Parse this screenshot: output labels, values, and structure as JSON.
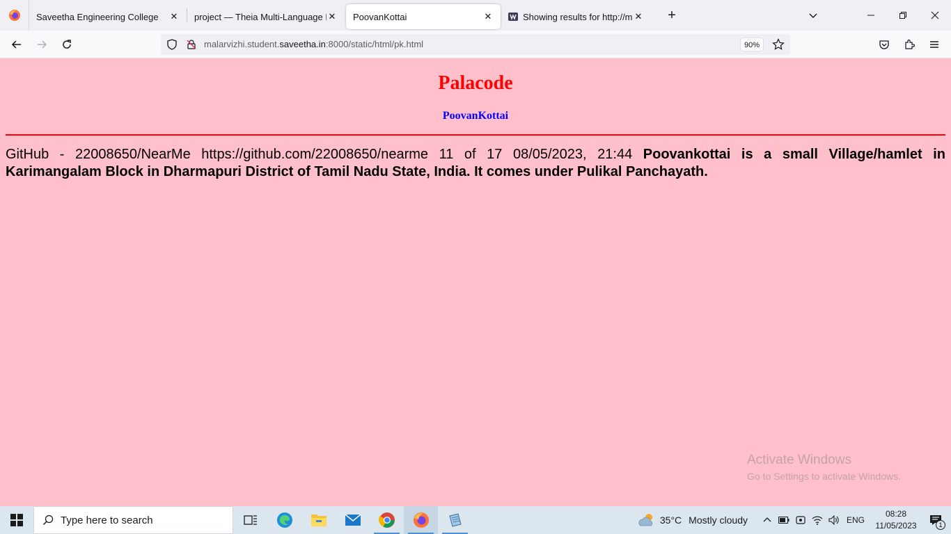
{
  "browser": {
    "tabs": [
      {
        "title": "Saveetha Engineering College",
        "active": false
      },
      {
        "title": "project — Theia Multi-Language Ex",
        "active": false
      },
      {
        "title": "PoovanKottai",
        "active": true
      },
      {
        "title": "Showing results for http://malar",
        "active": false
      }
    ],
    "url_prefix": "malarvizhi.student.",
    "url_host": "saveetha.in",
    "url_suffix": ":8000/static/html/pk.html",
    "zoom": "90%"
  },
  "page": {
    "title": "Palacode",
    "subtitle": "PoovanKottai",
    "paragraph_plain": "GitHub - 22008650/NearMe https://github.com/22008650/nearme 11 of 17 08/05/2023, 21:44 ",
    "paragraph_bold": "Poovankottai is a small Village/hamlet in Karimangalam Block in Dharmapuri District of Tamil Nadu State, India. It comes under Pulikal Panchayath.",
    "title_color": "#ff0000",
    "subtitle_color": "#0000ff",
    "background": "#ffc0cb"
  },
  "watermark": {
    "line1": "Activate Windows",
    "line2": "Go to Settings to activate Windows."
  },
  "taskbar": {
    "search_placeholder": "Type here to search",
    "weather_temp": "35°C",
    "weather_desc": "Mostly cloudy",
    "language": "ENG",
    "time": "08:28",
    "date": "11/05/2023",
    "notification_count": "1"
  }
}
